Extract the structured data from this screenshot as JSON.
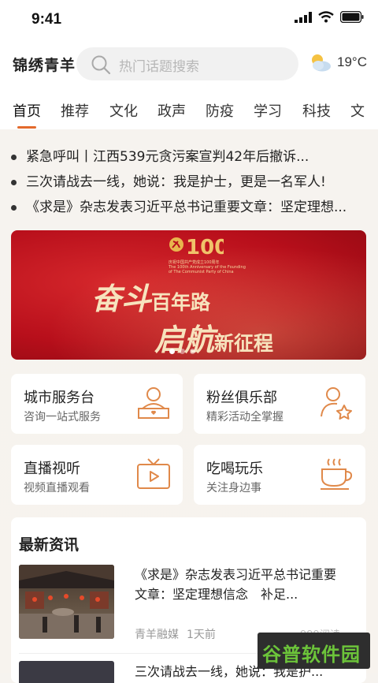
{
  "status_bar": {
    "time": "9:41"
  },
  "header": {
    "logo": "锦绣青羊",
    "search_placeholder": "热门话题搜索",
    "temperature": "19°C"
  },
  "tabs": [
    {
      "label": "首页",
      "active": true
    },
    {
      "label": "推荐"
    },
    {
      "label": "文化"
    },
    {
      "label": "政声"
    },
    {
      "label": "防疫"
    },
    {
      "label": "学习"
    },
    {
      "label": "科技"
    },
    {
      "label": "文"
    }
  ],
  "headlines": [
    "紧急呼叫丨江西539元贪污案宣判42年后撤诉...",
    "三次请战去一线，她说：我是护士，更是一名军人!",
    "《求是》杂志发表习近平总书记重要文章：坚定理想..."
  ],
  "banner": {
    "line1_big": "奋斗",
    "line1_small": "百年路",
    "line2_big": "启航",
    "line2_small": "新征程",
    "emblem_text": "100",
    "caption_cn": "庆祝中国共产党成立100周年",
    "caption_en": "The 100th Anniversary of the Founding of The Communist Party of China",
    "slides": 3,
    "active_slide": 1
  },
  "services": [
    {
      "title": "城市服务台",
      "subtitle": "咨询一站式服务",
      "icon": "service-desk-icon"
    },
    {
      "title": "粉丝俱乐部",
      "subtitle": "精彩活动全掌握",
      "icon": "fan-club-icon"
    },
    {
      "title": "直播视听",
      "subtitle": "视频直播观看",
      "icon": "live-tv-icon"
    },
    {
      "title": "吃喝玩乐",
      "subtitle": "关注身边事",
      "icon": "coffee-cup-icon"
    }
  ],
  "news": {
    "section_title": "最新资讯",
    "items": [
      {
        "title": "《求是》杂志发表习近平总书记重要文章：坚定理想信念　补足...",
        "source": "青羊融媒",
        "time": "1天前",
        "reads": "999阅读"
      },
      {
        "title": "三次请战去一线，她说：我是护..."
      }
    ]
  },
  "watermark": "谷普软件园",
  "colors": {
    "accent": "#e36a2c",
    "banner_red": "#b80f1b",
    "icon_orange": "#e0894a"
  }
}
